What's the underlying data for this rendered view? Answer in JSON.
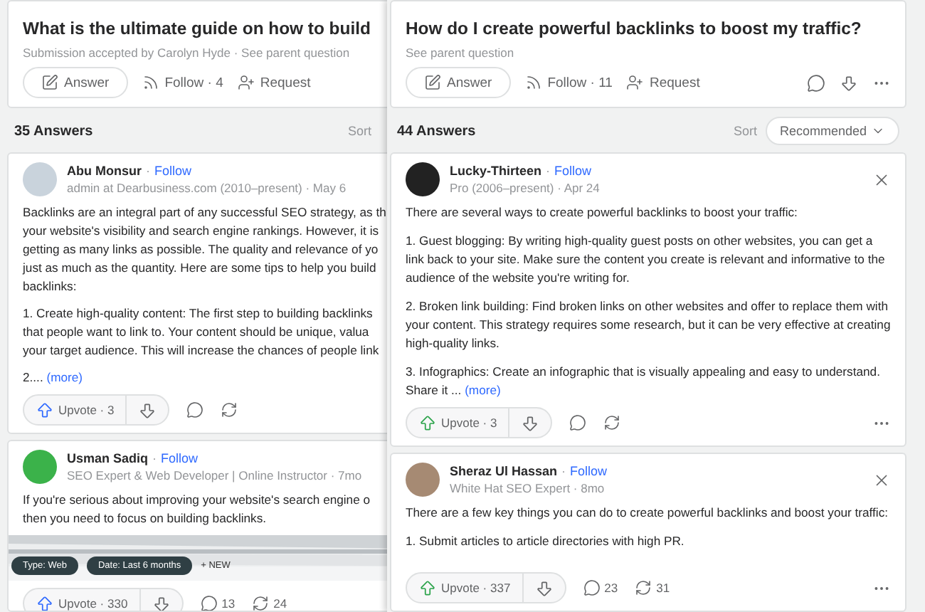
{
  "left_page": {
    "question": "What is the ultimate guide on how to build",
    "meta": "Submission accepted by Carolyn Hyde · See parent question",
    "actions": {
      "answer": "Answer",
      "follow": "Follow · 4",
      "request": "Request"
    },
    "answers_count": "35 Answers",
    "sort_label": "Sort",
    "answers": [
      {
        "author": "Abu Monsur",
        "separator": "·",
        "follow": "Follow",
        "credential": "admin at Dearbusiness.com (2010–present) · May 6",
        "paragraphs": [
          [
            "Backlinks are an integral part of any successful SEO strategy, as th",
            "your website's visibility and search engine rankings. However, it is",
            "getting as many links as possible. The quality and relevance of yo",
            "just as much as the quantity. Here are some tips to help you build",
            "backlinks:"
          ],
          [
            "1. Create high-quality content: The first step to building backlinks",
            "that people want to link to. Your content should be unique, valua",
            "your target audience. This will increase the chances of people link"
          ],
          [
            "2...."
          ]
        ],
        "more": "(more)",
        "upvote": "Upvote · 3"
      },
      {
        "author": "Usman Sadiq",
        "separator": "·",
        "follow": "Follow",
        "credential": "SEO Expert & Web Developer | Online Instructor · 7mo",
        "paragraphs": [
          [
            "If you're serious about improving your website's search engine o",
            "then you need to focus on building backlinks."
          ]
        ],
        "picture": {
          "kind": "picture",
          "chips": [
            "Type: Web",
            "Date: Last 6 months"
          ],
          "new_label": "+ NEW"
        },
        "upvote": "Upvote · 330",
        "comments": "13",
        "shares": "24"
      }
    ]
  },
  "right_page": {
    "question": "How do I create powerful backlinks to boost my traffic?",
    "meta": "See parent question",
    "actions": {
      "answer": "Answer",
      "follow": "Follow · 11",
      "request": "Request"
    },
    "answers_count": "44 Answers",
    "sort_label": "Sort",
    "sort_value": "Recommended",
    "answers": [
      {
        "author": "Lucky-Thirteen",
        "separator": "·",
        "follow": "Follow",
        "credential": "Pro (2006–present) · Apr 24",
        "paragraphs": [
          "There are several ways to create powerful backlinks to boost your traffic:",
          "1. Guest blogging: By writing high-quality guest posts on other websites, you can get a link back to your site. Make sure the content you create is relevant and informative to the audience of the website you're writing for.",
          "2. Broken link building: Find broken links on other websites and offer to replace them with your content. This strategy requires some research, but it can be very effective at creating high-quality links.",
          "3. Infographics: Create an infographic that is visually appealing and easy to understand. Share it ..."
        ],
        "more": "(more)",
        "upvote": "Upvote · 3"
      },
      {
        "author": "Sheraz Ul Hassan",
        "separator": "·",
        "follow": "Follow",
        "credential": "White Hat SEO Expert · 8mo",
        "paragraphs": [
          "There are a few key things you can do to create powerful backlinks and boost your traffic:",
          "1. Submit articles to article directories with high PR."
        ],
        "upvote": "Upvote · 337",
        "comments": "23",
        "shares": "31"
      }
    ]
  }
}
